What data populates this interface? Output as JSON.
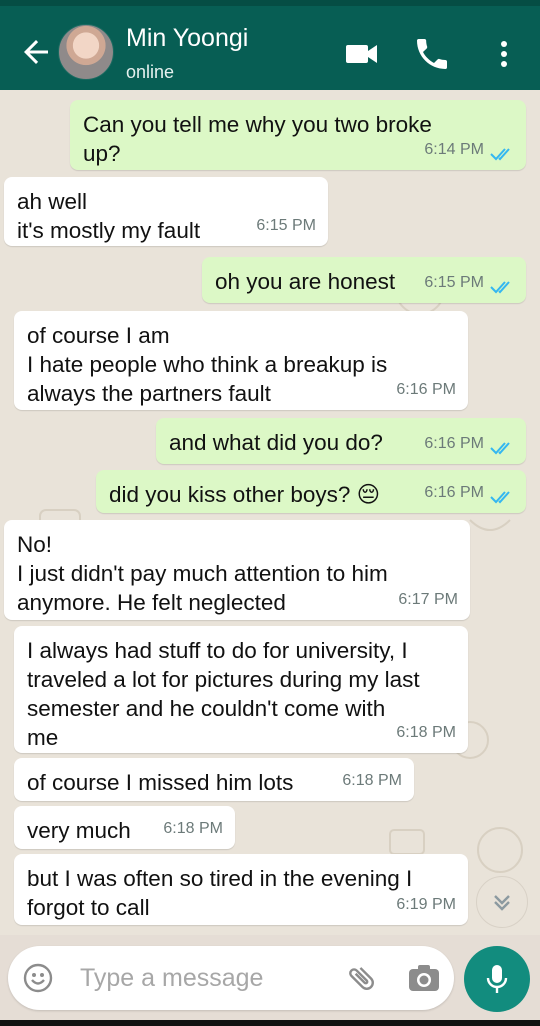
{
  "contact": {
    "name": "Min Yoongi",
    "status": "online"
  },
  "composer": {
    "placeholder": "Type a message"
  },
  "messages": [
    {
      "direction": "out",
      "text": "Can you tell me why you two broke\nup?",
      "time": "6:14 PM",
      "read": true
    },
    {
      "direction": "in",
      "text": "ah well\nit's mostly my fault",
      "time": "6:15 PM"
    },
    {
      "direction": "out",
      "text": "oh you are honest",
      "time": "6:15 PM",
      "read": true
    },
    {
      "direction": "in",
      "text": "of course I am\nI hate people who think a breakup is\nalways the partners fault",
      "time": "6:16 PM"
    },
    {
      "direction": "out",
      "text": "and what did you do?",
      "time": "6:16 PM",
      "read": true
    },
    {
      "direction": "out",
      "text": "did you kiss other boys? 😔",
      "time": "6:16 PM",
      "read": true
    },
    {
      "direction": "in",
      "text": "No!\nI just didn't pay much attention to him\nanymore. He felt neglected",
      "time": "6:17 PM"
    },
    {
      "direction": "in",
      "text": "I always had stuff to do for university, I\ntraveled a lot for pictures during my last\nsemester and he couldn't come with\nme",
      "time": "6:18 PM"
    },
    {
      "direction": "in",
      "text": "of course I missed him lots",
      "time": "6:18 PM"
    },
    {
      "direction": "in",
      "text": "very much",
      "time": "6:18 PM"
    },
    {
      "direction": "in",
      "text": "but I was often so tired in the evening I\nforgot to call",
      "time": "6:19 PM"
    }
  ],
  "colors": {
    "header": "#075e54",
    "incoming": "#ffffff",
    "outgoing": "#dcf8c6",
    "read_ticks": "#34b7f1",
    "mic": "#128c7e"
  }
}
